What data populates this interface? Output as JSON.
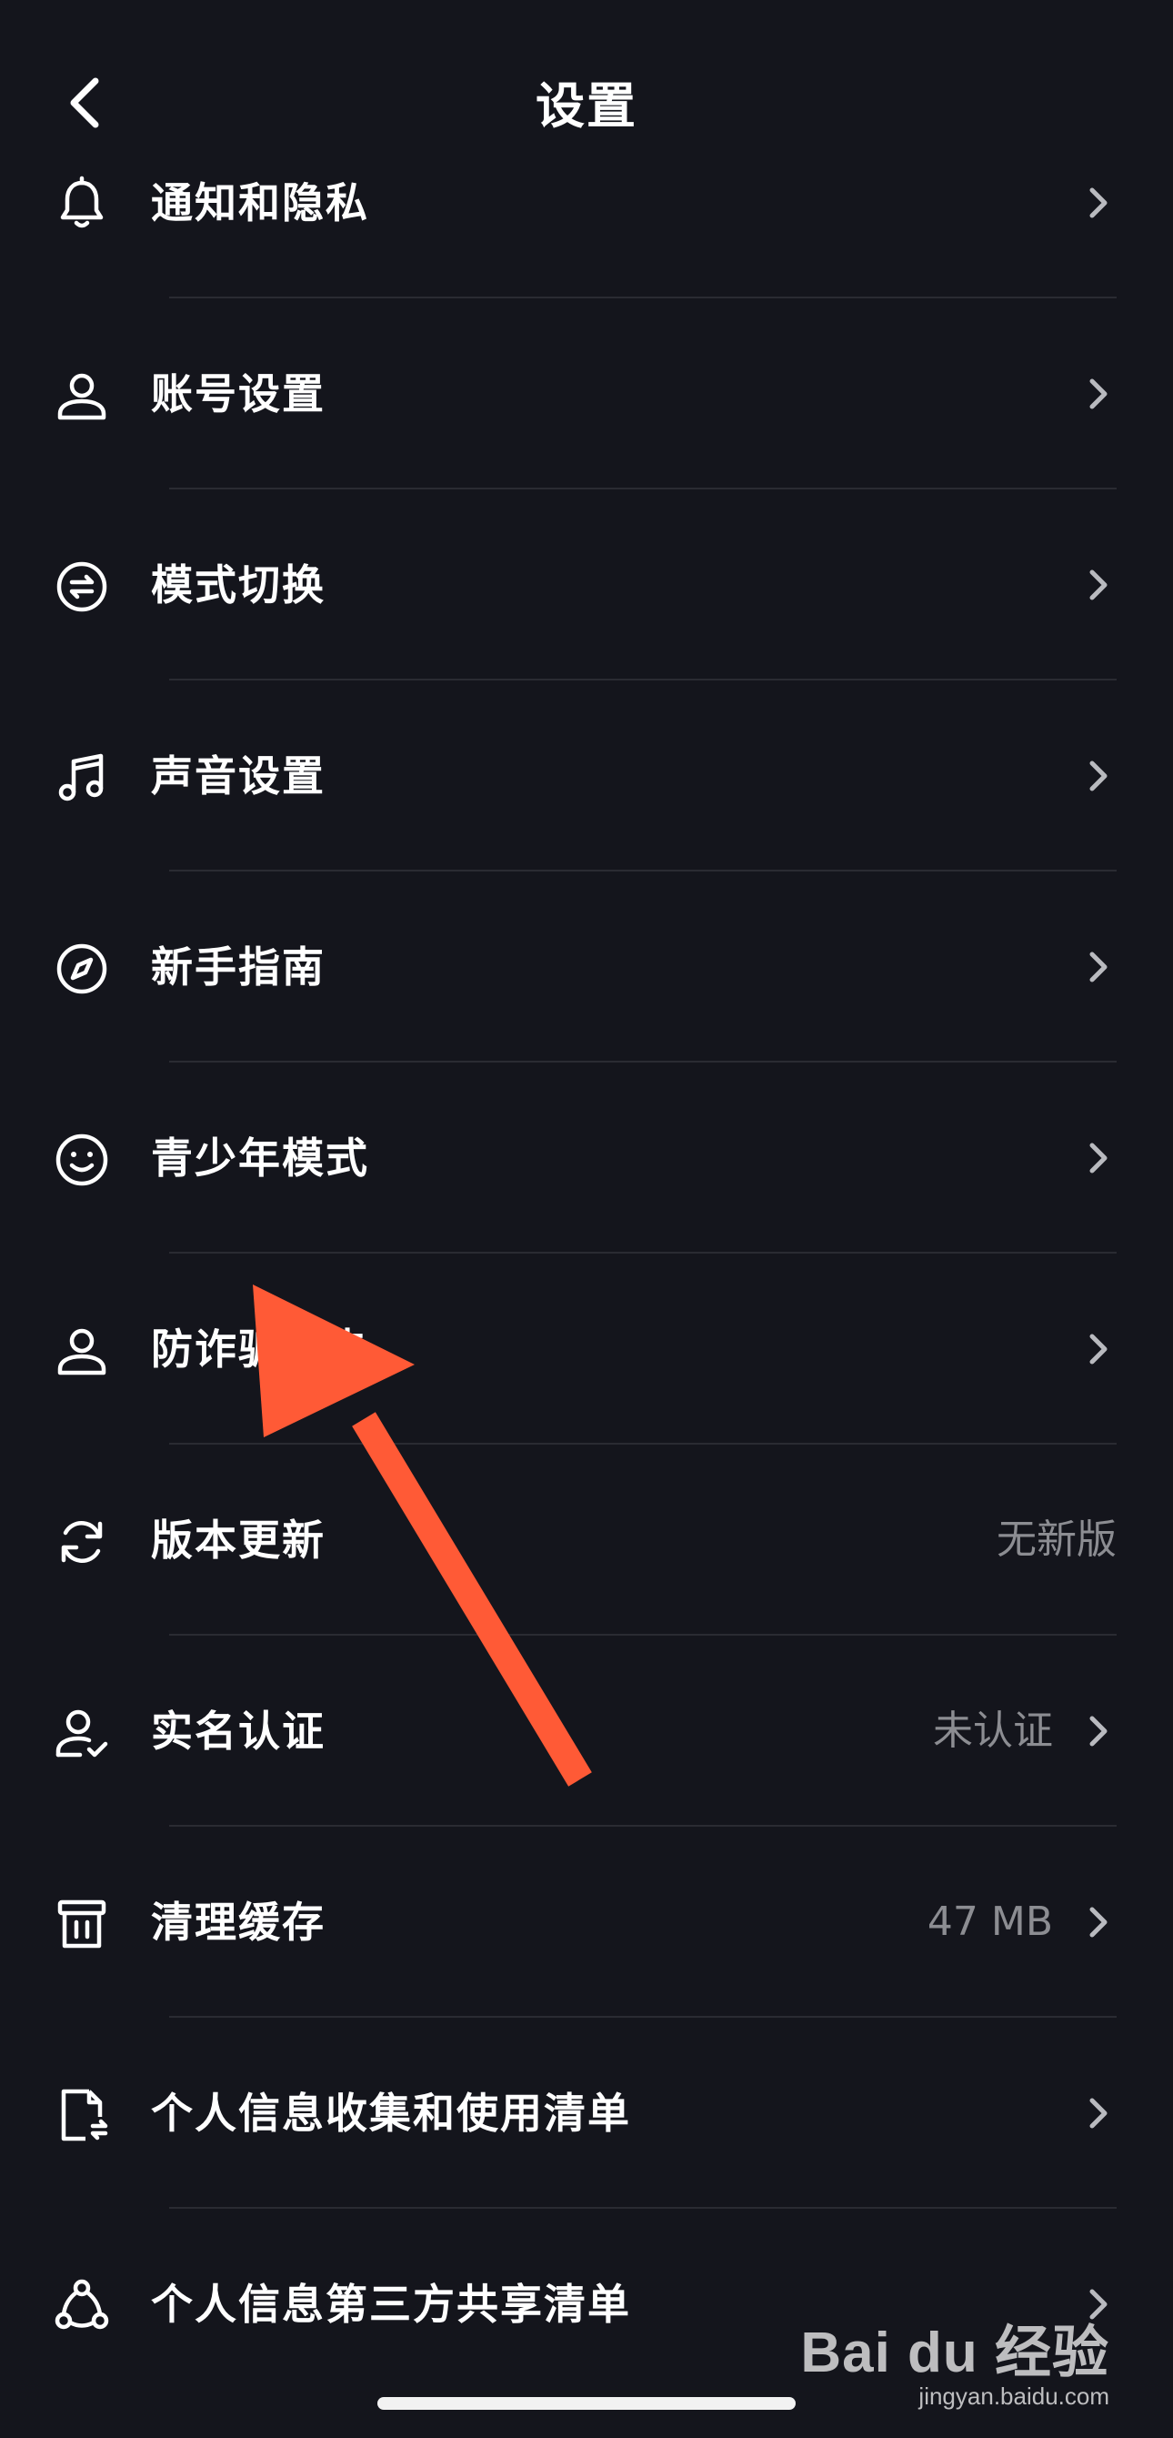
{
  "header": {
    "title": "设置",
    "back_icon": "chevron-left-icon"
  },
  "settings": {
    "items": [
      {
        "label": "通知和隐私",
        "icon": "bell-icon",
        "value": "",
        "chevron": true
      },
      {
        "label": "账号设置",
        "icon": "person-icon",
        "value": "",
        "chevron": true
      },
      {
        "label": "模式切换",
        "icon": "switch-icon",
        "value": "",
        "chevron": true
      },
      {
        "label": "声音设置",
        "icon": "music-note-icon",
        "value": "",
        "chevron": true
      },
      {
        "label": "新手指南",
        "icon": "compass-icon",
        "value": "",
        "chevron": true
      },
      {
        "label": "青少年模式",
        "icon": "smile-icon",
        "value": "",
        "chevron": true
      },
      {
        "label": "防诈骗公告",
        "icon": "person-icon",
        "value": "",
        "chevron": true
      },
      {
        "label": "版本更新",
        "icon": "refresh-icon",
        "value": "无新版",
        "chevron": false
      },
      {
        "label": "实名认证",
        "icon": "person-check-icon",
        "value": "未认证",
        "chevron": true
      },
      {
        "label": "清理缓存",
        "icon": "trash-icon",
        "value": "47 MB",
        "chevron": true
      },
      {
        "label": "个人信息收集和使用清单",
        "icon": "document-icon",
        "value": "",
        "chevron": true
      },
      {
        "label": "个人信息第三方共享清单",
        "icon": "share-icon",
        "value": "",
        "chevron": true
      }
    ]
  },
  "overlay": {
    "annotation_arrow_color": "#ff5a36",
    "annotation_target": "青少年模式"
  },
  "watermark": {
    "main": "Bai du 经验",
    "url": "jingyan.baidu.com"
  },
  "colors": {
    "background": "#14151c",
    "text": "#ffffff",
    "secondary_text": "#8c8d92",
    "divider": "#2a2b32"
  }
}
